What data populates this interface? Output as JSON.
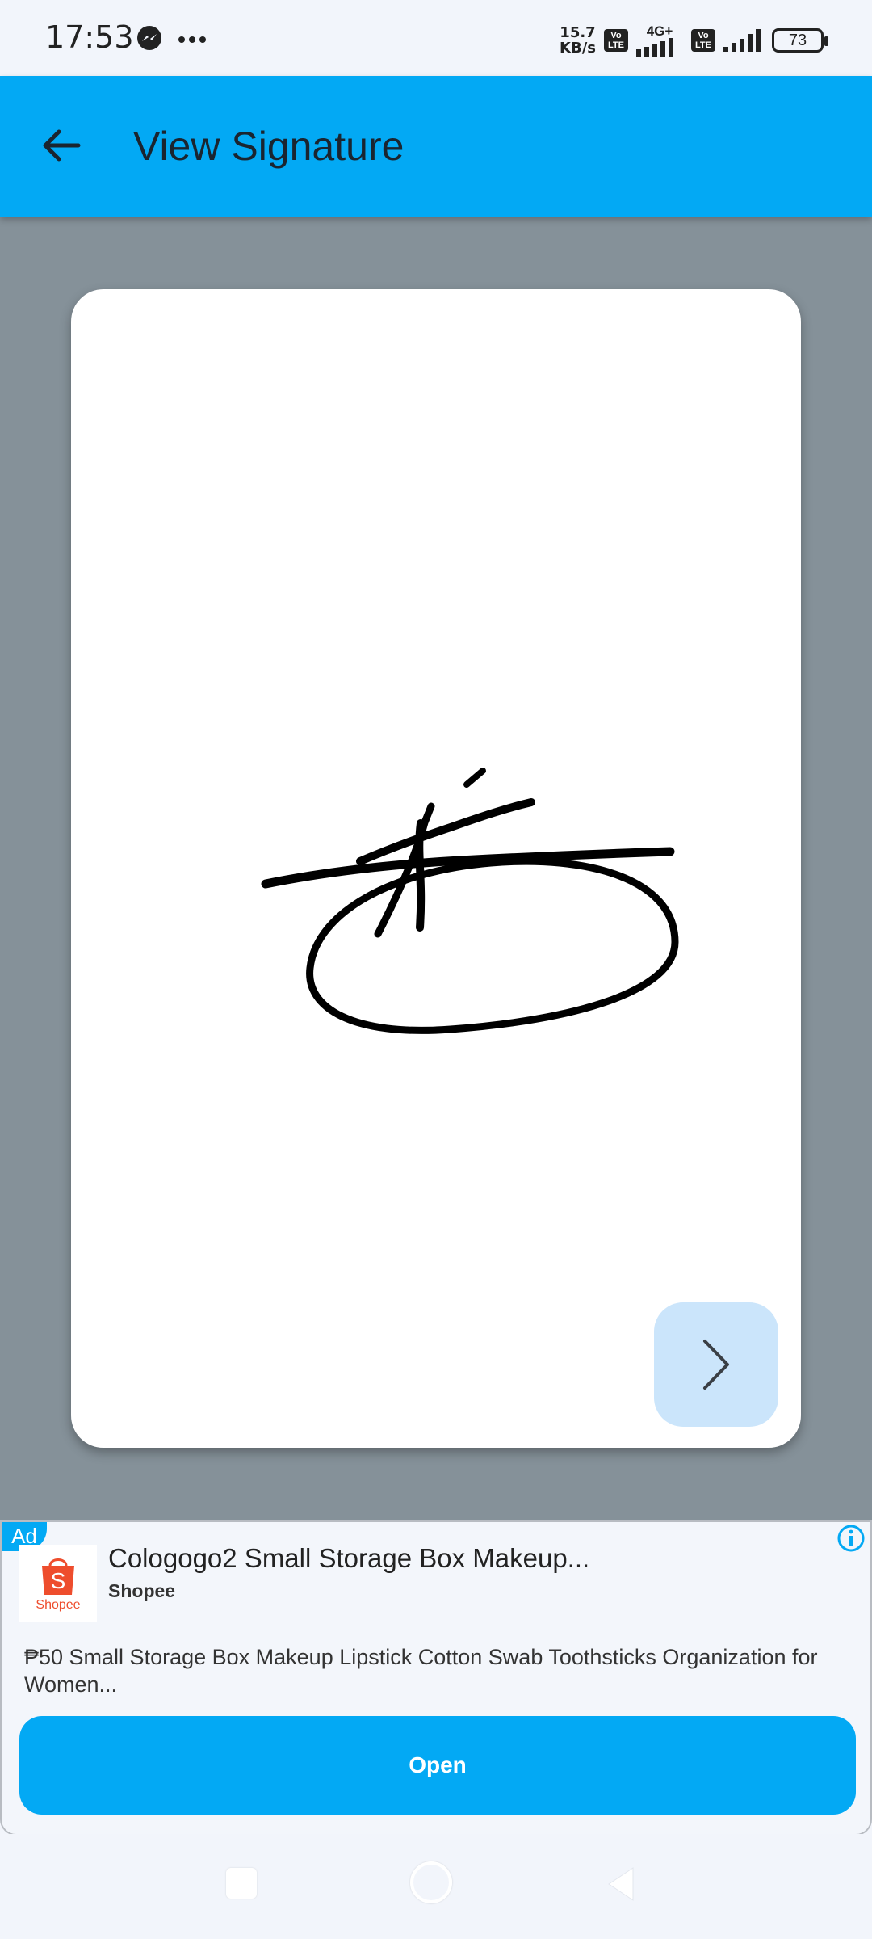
{
  "status_bar": {
    "time": "17:53",
    "speed_value": "15.7",
    "speed_unit": "KB/s",
    "sim1_badge": "Vo LTE",
    "network_type": "4G+",
    "sim2_badge": "Vo LTE",
    "battery": "73",
    "icons": [
      "messenger-icon",
      "more-icon",
      "signal-icon",
      "battery-icon"
    ]
  },
  "app_bar": {
    "title": "View Signature",
    "back_icon": "arrow-back-icon",
    "background": "#03a9f4"
  },
  "card": {
    "next_icon": "chevron-right-icon",
    "next_button_color": "#cbe5fb"
  },
  "ad": {
    "tag": "Ad",
    "logo_letter": "S",
    "logo_text": "Shopee",
    "title": "Cologogo2 Small Storage Box Makeup...",
    "advertiser": "Shopee",
    "description": "₱50 Small Storage Box Makeup Lipstick Cotton Swab Toothsticks Organization for Women...",
    "open_label": "Open",
    "accent": "#ee4d2d"
  },
  "nav_bar": {
    "icons": [
      "recents-icon",
      "home-icon",
      "back-icon"
    ]
  }
}
